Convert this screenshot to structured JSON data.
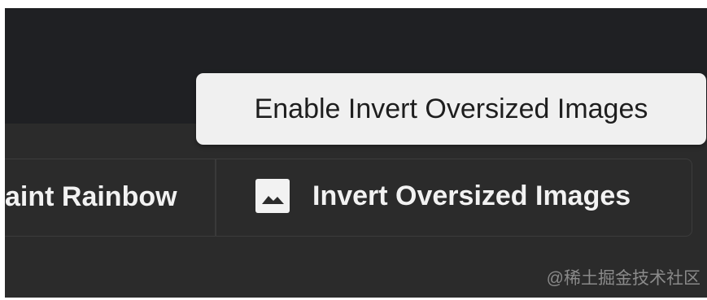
{
  "toolbar": {
    "buttons": [
      {
        "label": "aint Rainbow",
        "icon": "none"
      },
      {
        "label": "Invert Oversized Images",
        "icon": "image-icon"
      }
    ]
  },
  "tooltip": {
    "text": "Enable Invert Oversized Images"
  },
  "watermark": {
    "text": "@稀土掘金技术社区"
  },
  "colors": {
    "background": "#2b2b2b",
    "top_band": "#1f2023",
    "tooltip_bg": "#f0f0f0",
    "label_text": "#f2f2f2",
    "tooltip_text": "#1e1e1e"
  }
}
